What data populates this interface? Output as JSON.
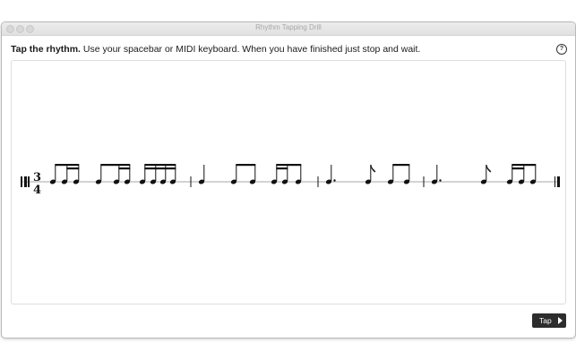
{
  "window": {
    "title": "Rhythm Tapping Drill"
  },
  "instructions": {
    "bold": "Tap the rhythm.",
    "rest": " Use your spacebar or MIDI keyboard. When you have finished just stop and wait."
  },
  "help": {
    "label": "?",
    "icon": "help-circle-icon"
  },
  "score": {
    "time_signature": {
      "numerator": "3",
      "denominator": "4"
    },
    "measures": [
      [
        "sixteenth group (8th + 2 16ths)",
        "sixteenth group (8th + 2 16ths)",
        "sixteenth group (4 16ths)"
      ],
      [
        "quarter",
        "eighth pair",
        "sixteenth group (2 16ths + 8th)"
      ],
      [
        "dotted quarter",
        "eighth",
        "eighth pair"
      ],
      [
        "dotted quarter",
        "eighth",
        "sixteenth group (2 16ths + 8th)"
      ]
    ]
  },
  "tap_button": {
    "label": "Tap",
    "icon": "play-triangle-icon"
  },
  "colors": {
    "ink": "#111111",
    "button_bg": "#2d2d2d",
    "panel_border": "#dedede"
  }
}
